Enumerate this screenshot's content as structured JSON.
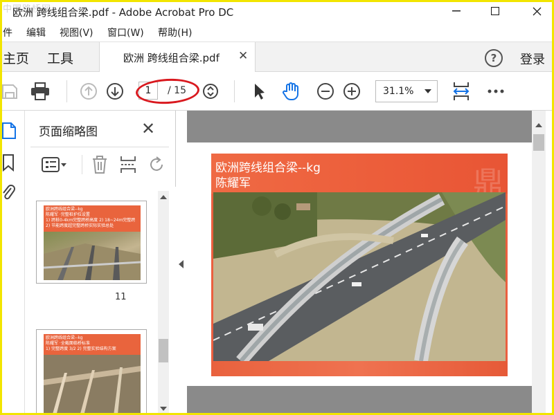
{
  "window": {
    "title": "欧洲 跨线组合梁.pdf - Adobe Acrobat Pro DC",
    "watermark": "中国路桥网",
    "minimize_icon": "minimize-icon",
    "maximize_icon": "maximize-icon",
    "close_icon": "close-icon"
  },
  "menu": {
    "items": [
      "件",
      "编辑",
      "视图(V)",
      "窗口(W)",
      "帮助(H)"
    ]
  },
  "tabs": {
    "home": "主页",
    "tools": "工具",
    "document": "欧洲 跨线组合梁.pdf",
    "login": "登录",
    "help": "?"
  },
  "toolbar": {
    "page_current": "1",
    "page_total": "/ 15",
    "zoom": "31.1%"
  },
  "thumbnails": {
    "title": "页面缩略图",
    "items": [
      {
        "label": "11",
        "header_lines": [
          "欧洲跨线组合梁--kg",
          "陈耀军 ·完整桩护拉设置",
          "1) 跨桩0-4km完整跨桥高度 2) 18~24m完整跨",
          "2) 节能跨度超完整跨桥实际实验总处"
        ]
      },
      {
        "label": "",
        "header_lines": [
          "欧洲跨线组合梁--kg",
          "陈耀军 ·全截面临桥标准",
          "1) 完整跨度 3/2 2) 完整实验结构方案"
        ]
      }
    ]
  },
  "document": {
    "title_line1": "欧洲跨线组合梁--kg",
    "title_line2": "陈耀军"
  },
  "colors": {
    "accent_red": "#d9191f",
    "slide_orange": "#eb5f3f",
    "frame_yellow": "#f2e500",
    "hand_blue": "#1473e6"
  }
}
